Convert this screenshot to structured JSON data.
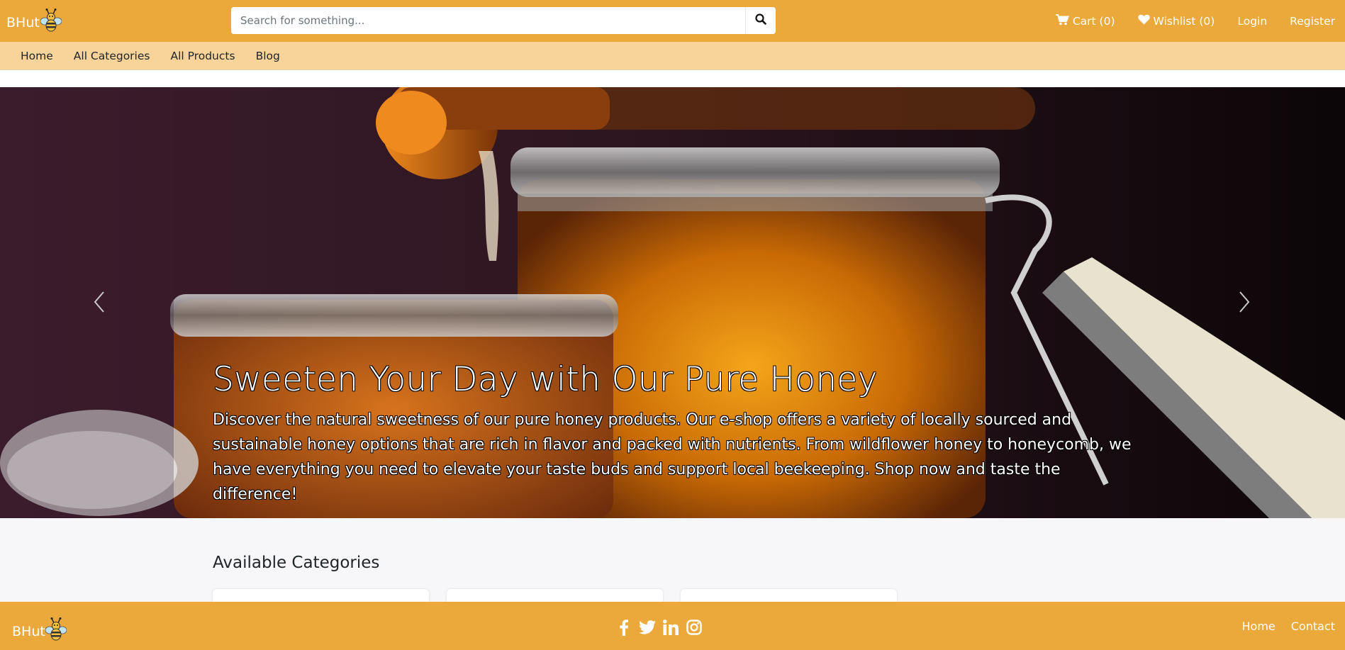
{
  "brand": {
    "name": "BHut",
    "logo_icon": "bee-icon"
  },
  "search": {
    "placeholder": "Search for something...",
    "icon": "search-icon"
  },
  "topnav": {
    "cart": "Cart (0)",
    "wishlist": "Wishlist (0)",
    "login": "Login",
    "register": "Register"
  },
  "subnav": {
    "items": [
      "Home",
      "All Categories",
      "All Products",
      "Blog"
    ]
  },
  "hero": {
    "title": "Sweeten Your Day with Our Pure Honey",
    "text": "Discover the natural sweetness of our pure honey products. Our e-shop offers a variety of locally sourced and sustainable honey options that are rich in flavor and packed with nutrients. From wildflower honey to honeycomb, we have everything you need to elevate your taste buds and support local beekeeping. Shop now and taste the difference!",
    "prev_icon": "chevron-left-icon",
    "next_icon": "chevron-right-icon"
  },
  "categories": {
    "title": "Available Categories"
  },
  "footer": {
    "brand": "BHut",
    "social_icons": [
      "facebook-icon",
      "twitter-icon",
      "linkedin-icon",
      "instagram-icon"
    ],
    "links": [
      "Home",
      "Contact"
    ]
  },
  "colors": {
    "primary": "#eaa93a",
    "subnav": "#f8d49b",
    "text": "#212529"
  }
}
